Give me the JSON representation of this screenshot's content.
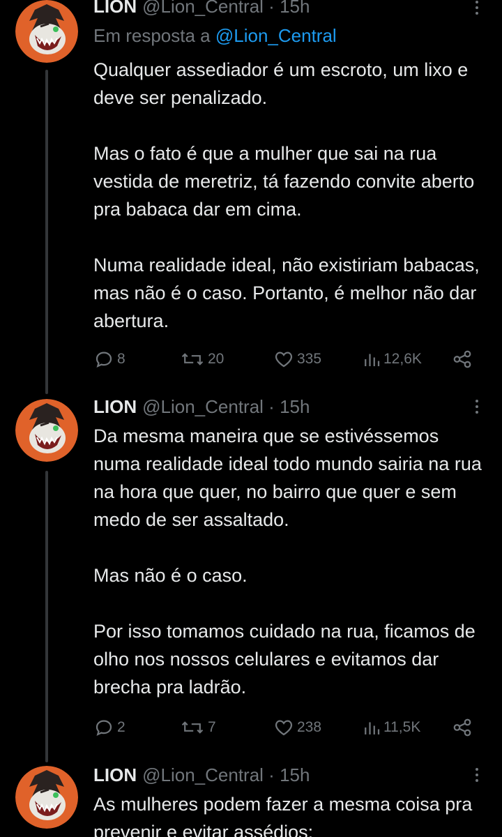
{
  "colors": {
    "background": "#000000",
    "text_primary": "#e7e9ea",
    "text_secondary": "#71767b",
    "link": "#1d9bf0",
    "thread_line": "#333639",
    "avatar_background": "#e0622a"
  },
  "tweets": [
    {
      "author_name": "LION",
      "handle": "@Lion_Central",
      "separator": "·",
      "time": "15h",
      "reply_prefix": "Em resposta a",
      "reply_handle": "@Lion_Central",
      "paragraphs": [
        "Qualquer assediador é um escroto, um lixo e deve ser penalizado.",
        "Mas o fato é que a mulher que sai na rua vestida de meretriz, tá fazendo convite aberto pra babaca dar em cima.",
        "Numa realidade ideal, não existiriam babacas, mas não é o caso. Portanto, é melhor não dar abertura."
      ],
      "stats": {
        "replies": "8",
        "retweets": "20",
        "likes": "335",
        "views": "12,6K"
      },
      "icons": [
        "reply-icon",
        "retweet-icon",
        "like-icon",
        "views-icon",
        "share-icon"
      ]
    },
    {
      "author_name": "LION",
      "handle": "@Lion_Central",
      "separator": "·",
      "time": "15h",
      "paragraphs": [
        "Da mesma maneira que se estivéssemos numa realidade ideal todo mundo sairia na rua na hora que quer, no bairro que quer e sem medo de ser assaltado.",
        "Mas não é o caso.",
        "Por isso tomamos cuidado na rua, ficamos de olho nos nossos celulares e evitamos dar brecha pra ladrão."
      ],
      "stats": {
        "replies": "2",
        "retweets": "7",
        "likes": "238",
        "views": "11,5K"
      },
      "icons": [
        "reply-icon",
        "retweet-icon",
        "like-icon",
        "views-icon",
        "share-icon"
      ]
    },
    {
      "author_name": "LION",
      "handle": "@Lion_Central",
      "separator": "·",
      "time": "15h",
      "paragraphs": [
        "As mulheres podem fazer a mesma coisa pra prevenir e evitar assédios:"
      ]
    }
  ]
}
